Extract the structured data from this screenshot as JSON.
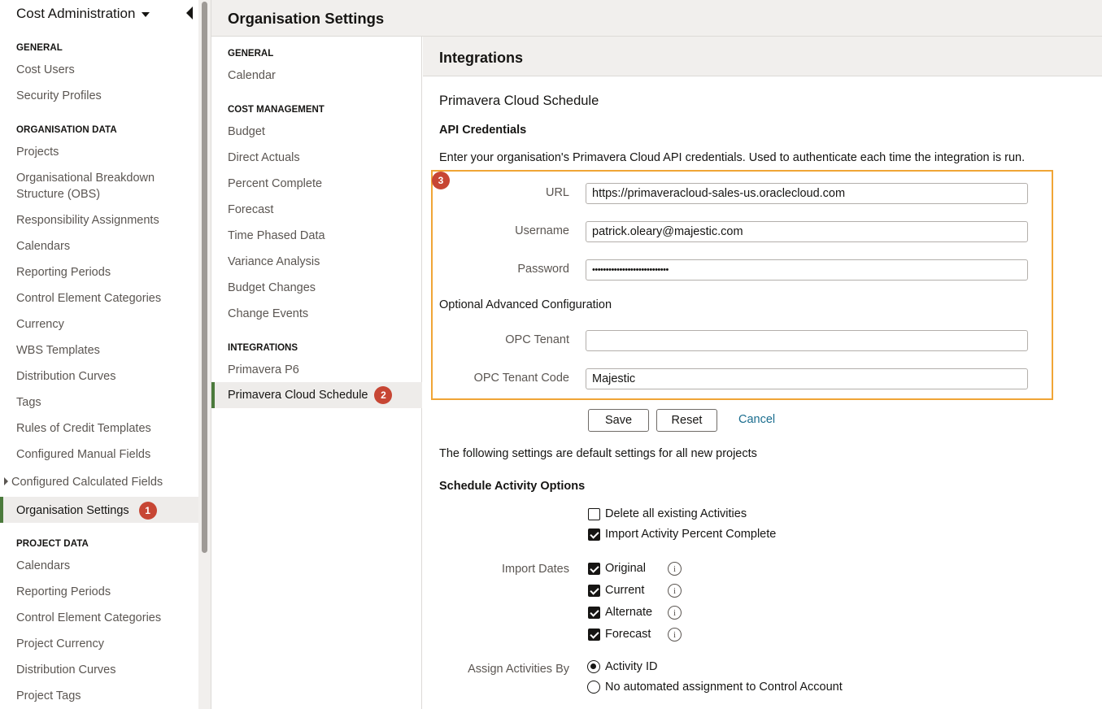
{
  "sidebar": {
    "app_title": "Cost Administration",
    "sections": [
      {
        "title": "GENERAL",
        "items": [
          "Cost Users",
          "Security Profiles"
        ]
      },
      {
        "title": "ORGANISATION DATA",
        "items": [
          "Projects",
          "Organisational Breakdown Structure (OBS)",
          "Responsibility Assignments",
          "Calendars",
          "Reporting Periods",
          "Control Element Categories",
          "Currency",
          "WBS Templates",
          "Distribution Curves",
          "Tags",
          "Rules of Credit Templates",
          "Configured Manual Fields",
          "Configured Calculated Fields",
          "Organisation Settings"
        ]
      },
      {
        "title": "PROJECT DATA",
        "items": [
          "Calendars",
          "Reporting Periods",
          "Control Element Categories",
          "Project Currency",
          "Distribution Curves",
          "Project Tags"
        ]
      }
    ],
    "active_badge": "1"
  },
  "header": {
    "title": "Organisation Settings"
  },
  "midnav": {
    "sections": [
      {
        "title": "GENERAL",
        "items": [
          "Calendar"
        ]
      },
      {
        "title": "COST MANAGEMENT",
        "items": [
          "Budget",
          "Direct Actuals",
          "Percent Complete",
          "Forecast",
          "Time Phased Data",
          "Variance Analysis",
          "Budget Changes",
          "Change Events"
        ]
      },
      {
        "title": "INTEGRATIONS",
        "items": [
          "Primavera P6",
          "Primavera Cloud Schedule"
        ]
      }
    ],
    "active_badge": "2"
  },
  "main": {
    "title": "Integrations",
    "subtitle": "Primavera Cloud Schedule",
    "api_heading": "API Credentials",
    "api_description": "Enter your organisation's Primavera Cloud API credentials. Used to authenticate each time the integration is run.",
    "highlight_badge": "3",
    "fields": {
      "url_label": "URL",
      "url_value": "https://primaveracloud-sales-us.oraclecloud.com",
      "username_label": "Username",
      "username_value": "patrick.oleary@majestic.com",
      "password_label": "Password",
      "password_value": "••••••••••••••••••••••••••••",
      "optional_heading": "Optional Advanced Configuration",
      "tenant_label": "OPC Tenant",
      "tenant_value": "",
      "tenant_code_label": "OPC Tenant Code",
      "tenant_code_value": "Majestic"
    },
    "buttons": {
      "save": "Save",
      "reset": "Reset",
      "cancel": "Cancel"
    },
    "defaults_note": "The following settings are default settings for all new projects",
    "schedule_heading": "Schedule Activity Options",
    "options": {
      "delete_existing": {
        "label": "Delete all existing Activities",
        "checked": false
      },
      "import_percent": {
        "label": "Import Activity Percent Complete",
        "checked": true
      }
    },
    "import_dates_label": "Import Dates",
    "import_dates": [
      {
        "label": "Original",
        "checked": true
      },
      {
        "label": "Current",
        "checked": true
      },
      {
        "label": "Alternate",
        "checked": true
      },
      {
        "label": "Forecast",
        "checked": true
      }
    ],
    "assign_label": "Assign Activities By",
    "assign_options": [
      {
        "label": "Activity ID",
        "selected": true
      },
      {
        "label": "No automated assignment to Control Account",
        "selected": false
      }
    ]
  }
}
